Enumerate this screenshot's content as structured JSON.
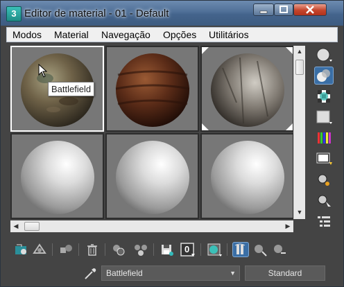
{
  "window": {
    "title": "Editor de material - 01 - Default",
    "app_icon_glyph": "3"
  },
  "menu": [
    "Modos",
    "Material",
    "Navegação",
    "Opções",
    "Utilitários"
  ],
  "tooltip": "Battlefield",
  "material_name": "Battlefield",
  "material_type": "Standard",
  "sample_slots": [
    {
      "kind": "textured",
      "texture": "battlefield-dirt",
      "colors": [
        "#8a8466",
        "#5a4a34",
        "#3f3a2e"
      ],
      "selected": true
    },
    {
      "kind": "textured",
      "texture": "wood-bark",
      "colors": [
        "#6b3a22",
        "#3a1a10",
        "#1e0c07"
      ],
      "selected": false
    },
    {
      "kind": "textured",
      "texture": "stone-ruins",
      "colors": [
        "#b8b4ac",
        "#6e6860",
        "#2c2824"
      ],
      "selected": false
    },
    {
      "kind": "default",
      "colors": [
        "#ffffff",
        "#c6c6c6",
        "#7a7a7a"
      ],
      "selected": false
    },
    {
      "kind": "default",
      "colors": [
        "#ffffff",
        "#c6c6c6",
        "#7a7a7a"
      ],
      "selected": false
    },
    {
      "kind": "default",
      "colors": [
        "#ffffff",
        "#c6c6c6",
        "#7a7a7a"
      ],
      "selected": false
    }
  ],
  "side_tools": [
    "sample-type-sphere-icon",
    "backlight-icon",
    "checker-background-icon",
    "sample-uv-tiling-icon",
    "video-color-check-icon",
    "make-preview-icon",
    "options-icon",
    "select-by-material-icon",
    "material-map-navigator-icon"
  ],
  "bottom_tools": [
    "get-material-icon",
    "put-to-scene-icon",
    "assign-to-selection-icon",
    "reset-map-icon",
    "make-unique-icon",
    "make-copy-icon",
    "put-to-library-icon",
    "material-id-channel-icon",
    "show-map-in-viewport-icon",
    "show-end-result-icon",
    "go-to-parent-icon",
    "go-forward-to-sibling-icon"
  ],
  "material_id_value": "0",
  "colors": {
    "accent": "#3a6ea5",
    "panel": "#444444",
    "title_top": "#6d8bb0",
    "close": "#c4452c"
  }
}
